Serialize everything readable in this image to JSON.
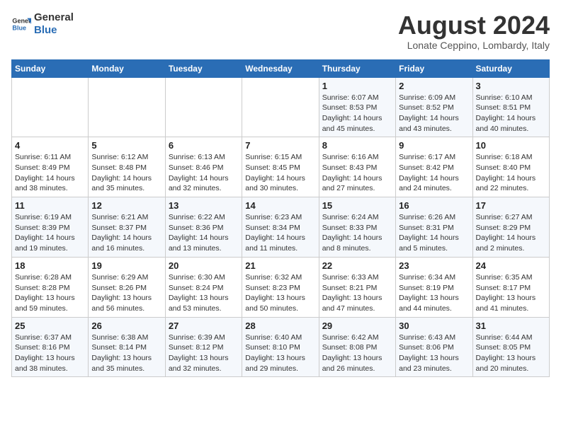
{
  "header": {
    "logo_line1": "General",
    "logo_line2": "Blue",
    "month": "August 2024",
    "location": "Lonate Ceppino, Lombardy, Italy"
  },
  "days_of_week": [
    "Sunday",
    "Monday",
    "Tuesday",
    "Wednesday",
    "Thursday",
    "Friday",
    "Saturday"
  ],
  "weeks": [
    [
      {
        "day": "",
        "info": ""
      },
      {
        "day": "",
        "info": ""
      },
      {
        "day": "",
        "info": ""
      },
      {
        "day": "",
        "info": ""
      },
      {
        "day": "1",
        "info": "Sunrise: 6:07 AM\nSunset: 8:53 PM\nDaylight: 14 hours and 45 minutes."
      },
      {
        "day": "2",
        "info": "Sunrise: 6:09 AM\nSunset: 8:52 PM\nDaylight: 14 hours and 43 minutes."
      },
      {
        "day": "3",
        "info": "Sunrise: 6:10 AM\nSunset: 8:51 PM\nDaylight: 14 hours and 40 minutes."
      }
    ],
    [
      {
        "day": "4",
        "info": "Sunrise: 6:11 AM\nSunset: 8:49 PM\nDaylight: 14 hours and 38 minutes."
      },
      {
        "day": "5",
        "info": "Sunrise: 6:12 AM\nSunset: 8:48 PM\nDaylight: 14 hours and 35 minutes."
      },
      {
        "day": "6",
        "info": "Sunrise: 6:13 AM\nSunset: 8:46 PM\nDaylight: 14 hours and 32 minutes."
      },
      {
        "day": "7",
        "info": "Sunrise: 6:15 AM\nSunset: 8:45 PM\nDaylight: 14 hours and 30 minutes."
      },
      {
        "day": "8",
        "info": "Sunrise: 6:16 AM\nSunset: 8:43 PM\nDaylight: 14 hours and 27 minutes."
      },
      {
        "day": "9",
        "info": "Sunrise: 6:17 AM\nSunset: 8:42 PM\nDaylight: 14 hours and 24 minutes."
      },
      {
        "day": "10",
        "info": "Sunrise: 6:18 AM\nSunset: 8:40 PM\nDaylight: 14 hours and 22 minutes."
      }
    ],
    [
      {
        "day": "11",
        "info": "Sunrise: 6:19 AM\nSunset: 8:39 PM\nDaylight: 14 hours and 19 minutes."
      },
      {
        "day": "12",
        "info": "Sunrise: 6:21 AM\nSunset: 8:37 PM\nDaylight: 14 hours and 16 minutes."
      },
      {
        "day": "13",
        "info": "Sunrise: 6:22 AM\nSunset: 8:36 PM\nDaylight: 14 hours and 13 minutes."
      },
      {
        "day": "14",
        "info": "Sunrise: 6:23 AM\nSunset: 8:34 PM\nDaylight: 14 hours and 11 minutes."
      },
      {
        "day": "15",
        "info": "Sunrise: 6:24 AM\nSunset: 8:33 PM\nDaylight: 14 hours and 8 minutes."
      },
      {
        "day": "16",
        "info": "Sunrise: 6:26 AM\nSunset: 8:31 PM\nDaylight: 14 hours and 5 minutes."
      },
      {
        "day": "17",
        "info": "Sunrise: 6:27 AM\nSunset: 8:29 PM\nDaylight: 14 hours and 2 minutes."
      }
    ],
    [
      {
        "day": "18",
        "info": "Sunrise: 6:28 AM\nSunset: 8:28 PM\nDaylight: 13 hours and 59 minutes."
      },
      {
        "day": "19",
        "info": "Sunrise: 6:29 AM\nSunset: 8:26 PM\nDaylight: 13 hours and 56 minutes."
      },
      {
        "day": "20",
        "info": "Sunrise: 6:30 AM\nSunset: 8:24 PM\nDaylight: 13 hours and 53 minutes."
      },
      {
        "day": "21",
        "info": "Sunrise: 6:32 AM\nSunset: 8:23 PM\nDaylight: 13 hours and 50 minutes."
      },
      {
        "day": "22",
        "info": "Sunrise: 6:33 AM\nSunset: 8:21 PM\nDaylight: 13 hours and 47 minutes."
      },
      {
        "day": "23",
        "info": "Sunrise: 6:34 AM\nSunset: 8:19 PM\nDaylight: 13 hours and 44 minutes."
      },
      {
        "day": "24",
        "info": "Sunrise: 6:35 AM\nSunset: 8:17 PM\nDaylight: 13 hours and 41 minutes."
      }
    ],
    [
      {
        "day": "25",
        "info": "Sunrise: 6:37 AM\nSunset: 8:16 PM\nDaylight: 13 hours and 38 minutes."
      },
      {
        "day": "26",
        "info": "Sunrise: 6:38 AM\nSunset: 8:14 PM\nDaylight: 13 hours and 35 minutes."
      },
      {
        "day": "27",
        "info": "Sunrise: 6:39 AM\nSunset: 8:12 PM\nDaylight: 13 hours and 32 minutes."
      },
      {
        "day": "28",
        "info": "Sunrise: 6:40 AM\nSunset: 8:10 PM\nDaylight: 13 hours and 29 minutes."
      },
      {
        "day": "29",
        "info": "Sunrise: 6:42 AM\nSunset: 8:08 PM\nDaylight: 13 hours and 26 minutes."
      },
      {
        "day": "30",
        "info": "Sunrise: 6:43 AM\nSunset: 8:06 PM\nDaylight: 13 hours and 23 minutes."
      },
      {
        "day": "31",
        "info": "Sunrise: 6:44 AM\nSunset: 8:05 PM\nDaylight: 13 hours and 20 minutes."
      }
    ]
  ]
}
